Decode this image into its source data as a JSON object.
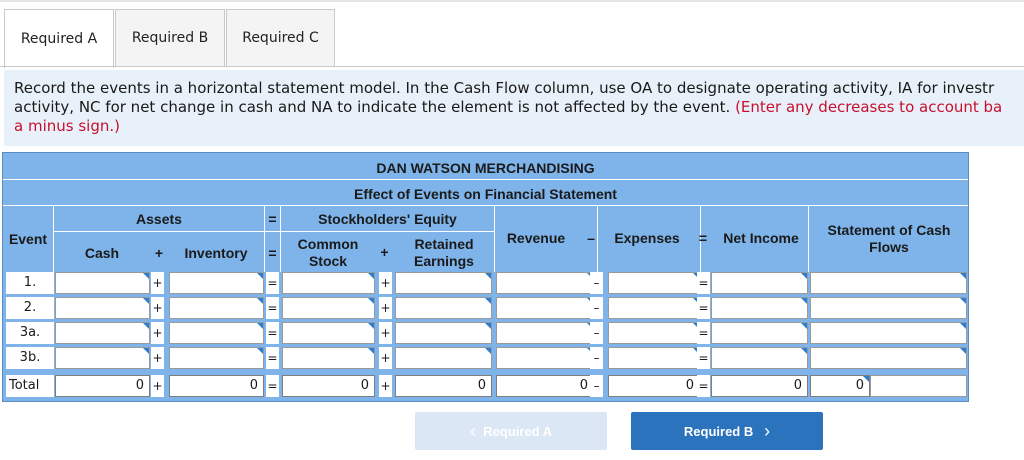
{
  "tabs": [
    {
      "label": "Required A",
      "active": true
    },
    {
      "label": "Required B",
      "active": false
    },
    {
      "label": "Required C",
      "active": false
    }
  ],
  "instructions": {
    "text": "Record the events in a horizontal statement model. In the Cash Flow column, use OA to designate operating activity, IA for investr",
    "text2": "activity, NC for net change in cash and NA to indicate the element is not affected by the event.",
    "red1": "(Enter any decreases to account ba",
    "red2": "a minus sign.)"
  },
  "model": {
    "company": "DAN WATSON MERCHANDISING",
    "subtitle": "Effect of Events on Financial Statement",
    "headers": {
      "event": "Event",
      "assets": "Assets",
      "equals": "=",
      "stockholders_equity": "Stockholders' Equity",
      "cash": "Cash",
      "plus": "+",
      "inventory": "Inventory",
      "common_stock": "Common Stock",
      "retained_earnings": "Retained Earnings",
      "revenue": "Revenue",
      "minus": "–",
      "expenses": "Expenses",
      "net_income": "Net Income",
      "cash_flows": "Statement of Cash Flows"
    },
    "rows": [
      {
        "event": "1.",
        "values": [
          "",
          "",
          "",
          "",
          "",
          "",
          "",
          ""
        ]
      },
      {
        "event": "2.",
        "values": [
          "",
          "",
          "",
          "",
          "",
          "",
          "",
          ""
        ]
      },
      {
        "event": "3a.",
        "values": [
          "",
          "",
          "",
          "",
          "",
          "",
          "",
          ""
        ]
      },
      {
        "event": "3b.",
        "values": [
          "",
          "",
          "",
          "",
          "",
          "",
          "",
          ""
        ]
      }
    ],
    "total": {
      "event": "Total",
      "values": [
        "0",
        "0",
        "0",
        "0",
        "0",
        "0",
        "0",
        "0"
      ]
    },
    "operators": [
      "+",
      "=",
      "+",
      "",
      "–",
      "=",
      ""
    ]
  },
  "nav": {
    "prev_label": "Required A",
    "next_label": "Required B",
    "prev_icon": "chevron-left-icon",
    "next_icon": "chevron-right-icon"
  }
}
